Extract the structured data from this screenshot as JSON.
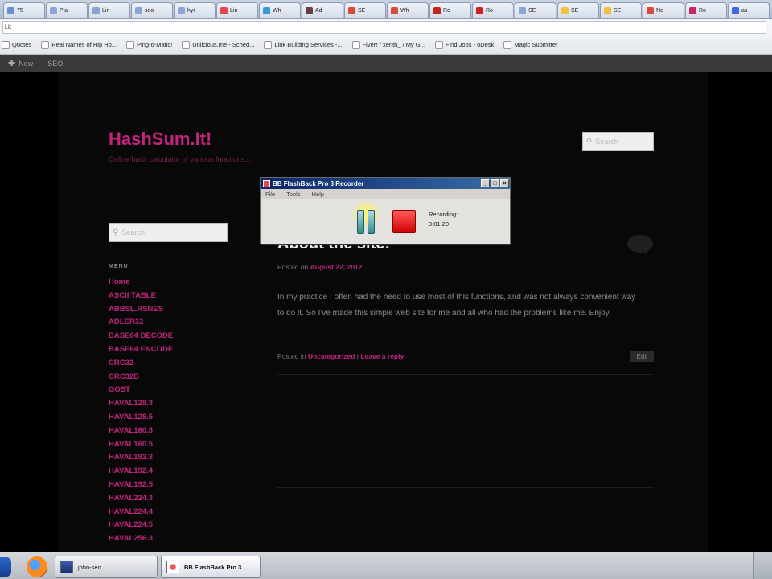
{
  "browser": {
    "tabs": [
      {
        "label": "75",
        "color": "#6a8fd6"
      },
      {
        "label": "Pla",
        "color": "#8aa4d6"
      },
      {
        "label": "Lin",
        "color": "#8aa4d6"
      },
      {
        "label": "seo",
        "color": "#8aa4d6"
      },
      {
        "label": "hyr",
        "color": "#8aa4d6"
      },
      {
        "label": "Lin",
        "color": "#e0484f"
      },
      {
        "label": "Wh",
        "color": "#3a9ad9"
      },
      {
        "label": "Ad",
        "color": "#6b3d3d"
      },
      {
        "label": "SE",
        "color": "#d94a3a"
      },
      {
        "label": "Wh",
        "color": "#d94a3a"
      },
      {
        "label": "Ro",
        "color": "#cc2222"
      },
      {
        "label": "Ro",
        "color": "#cc2222"
      },
      {
        "label": "SE",
        "color": "#8aa4d6"
      },
      {
        "label": "SE",
        "color": "#f0c040"
      },
      {
        "label": "SE",
        "color": "#f0c040"
      },
      {
        "label": "Ne",
        "color": "#d94a3a"
      },
      {
        "label": "Ro",
        "color": "#cc2266"
      },
      {
        "label": "as",
        "color": "#3a6ad9"
      }
    ],
    "url": "i.it",
    "bookmarks": [
      {
        "label": "Quotes"
      },
      {
        "label": "Real Names of Hip Ho..."
      },
      {
        "label": "Ping-o-Matic!"
      },
      {
        "label": "Unlicious.me - Sched..."
      },
      {
        "label": "Link Building Services -..."
      },
      {
        "label": "Fiverr / xerith_ / My G..."
      },
      {
        "label": "Find Jobs - oDesk"
      },
      {
        "label": "Magic Submitter"
      }
    ]
  },
  "adminbar": {
    "new_label": "New",
    "seo_label": "SEO"
  },
  "site": {
    "title": "HashSum.It!",
    "description": "Online hash calculator of various functions...",
    "search_placeholder": "Search",
    "sidebar_search_placeholder": "Search"
  },
  "menu": {
    "title": "MENU",
    "items": [
      "Home",
      "ASCII TABLE",
      "ABBSL.RSNES",
      "ADLER32",
      "BASE64 DECODE",
      "BASE64 ENCODE",
      "CRC32",
      "CRC32B",
      "GOST",
      "HAVAL128.3",
      "HAVAL128.5",
      "HAVAL160.3",
      "HAVAL160.5",
      "HAVAL192.3",
      "HAVAL192.4",
      "HAVAL192.5",
      "HAVAL224.3",
      "HAVAL224.4",
      "HAVAL224.5",
      "HAVAL256.3"
    ]
  },
  "post": {
    "title": "About the site!",
    "posted_on": "Posted on",
    "date": "August 22, 2012",
    "body": "In my practice I often had the need to use most of this functions, and was not always convenient way to do it. So I've made this simple web site for me and all who had the problems like me. Enjoy.",
    "posted_in": "Posted in",
    "category": "Uncategorized",
    "separator": " | ",
    "reply": "Leave a reply",
    "edit": "Edit"
  },
  "recorder": {
    "title": "BB FlashBack Pro 3 Recorder",
    "menu": [
      "File",
      "Tools",
      "Help"
    ],
    "status_label": "Recording",
    "time": "0:01:20"
  },
  "taskbar": {
    "task1": "john-seo",
    "task2": "BB FlashBack Pro 3..."
  }
}
